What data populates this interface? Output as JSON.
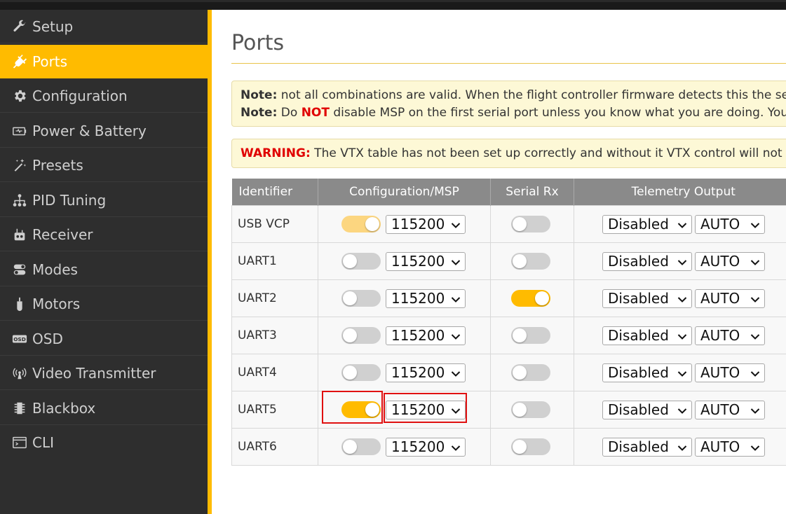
{
  "sidebar": {
    "items": [
      {
        "label": "Setup",
        "icon": "wrench-icon",
        "active": false
      },
      {
        "label": "Ports",
        "icon": "plug-icon",
        "active": true
      },
      {
        "label": "Configuration",
        "icon": "gear-icon",
        "active": false
      },
      {
        "label": "Power & Battery",
        "icon": "battery-icon",
        "active": false
      },
      {
        "label": "Presets",
        "icon": "magic-wand-icon",
        "active": false
      },
      {
        "label": "PID Tuning",
        "icon": "sitemap-icon",
        "active": false
      },
      {
        "label": "Receiver",
        "icon": "remote-icon",
        "active": false
      },
      {
        "label": "Modes",
        "icon": "toggles-icon",
        "active": false
      },
      {
        "label": "Motors",
        "icon": "motor-icon",
        "active": false
      },
      {
        "label": "OSD",
        "icon": "osd-icon",
        "active": false
      },
      {
        "label": "Video Transmitter",
        "icon": "broadcast-icon",
        "active": false
      },
      {
        "label": "Blackbox",
        "icon": "chip-icon",
        "active": false
      },
      {
        "label": "CLI",
        "icon": "terminal-icon",
        "active": false
      }
    ]
  },
  "main": {
    "title": "Ports",
    "note1": {
      "label": "Note:",
      "text": " not all combinations are valid. When the flight controller firmware detects this the seria"
    },
    "note2": {
      "label": "Note:",
      "pre": " Do ",
      "emph": "NOT",
      "text": " disable MSP on the first serial port unless you know what you are doing. You m"
    },
    "warning": {
      "label": "WARNING:",
      "text": " The VTX table has not been set up correctly and without it VTX control will not be p"
    }
  },
  "table": {
    "headers": [
      "Identifier",
      "Configuration/MSP",
      "Serial Rx",
      "Telemetry Output"
    ],
    "rows": [
      {
        "id": "USB VCP",
        "msp": true,
        "msp_pale": true,
        "baud": "115200",
        "serial_rx": false,
        "telemetry": "Disabled",
        "tele_baud": "AUTO"
      },
      {
        "id": "UART1",
        "msp": false,
        "baud": "115200",
        "serial_rx": false,
        "telemetry": "Disabled",
        "tele_baud": "AUTO"
      },
      {
        "id": "UART2",
        "msp": false,
        "baud": "115200",
        "serial_rx": true,
        "telemetry": "Disabled",
        "tele_baud": "AUTO"
      },
      {
        "id": "UART3",
        "msp": false,
        "baud": "115200",
        "serial_rx": false,
        "telemetry": "Disabled",
        "tele_baud": "AUTO"
      },
      {
        "id": "UART4",
        "msp": false,
        "baud": "115200",
        "serial_rx": false,
        "telemetry": "Disabled",
        "tele_baud": "AUTO"
      },
      {
        "id": "UART5",
        "msp": true,
        "baud": "115200",
        "serial_rx": false,
        "telemetry": "Disabled",
        "tele_baud": "AUTO",
        "highlighted": true
      },
      {
        "id": "UART6",
        "msp": false,
        "baud": "115200",
        "serial_rx": false,
        "telemetry": "Disabled",
        "tele_baud": "AUTO"
      }
    ]
  },
  "colors": {
    "accent": "#ffbb00",
    "sidebar_bg": "#2e2e2e",
    "highlight": "#e01010",
    "warning_red": "#e00000"
  }
}
